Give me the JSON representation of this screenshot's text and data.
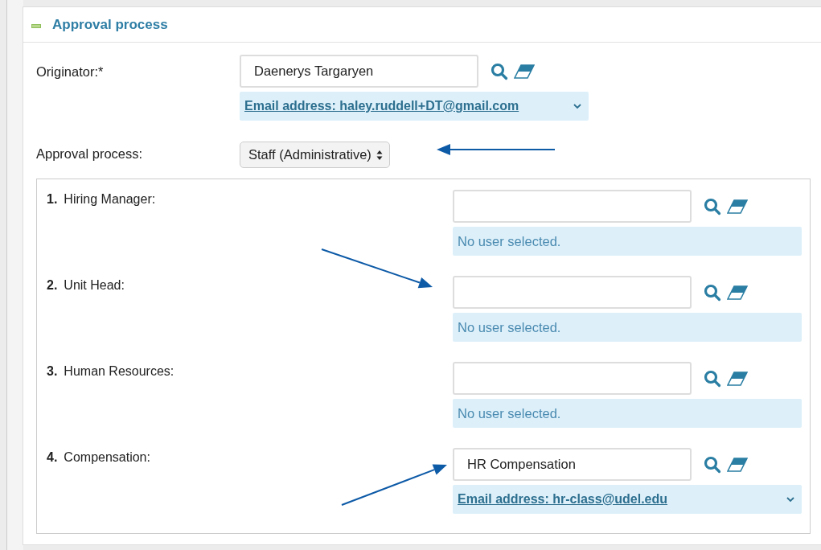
{
  "section": {
    "title": "Approval process",
    "expanded": true
  },
  "originator": {
    "label": "Originator:*",
    "value": "Daenerys Targaryen",
    "info": {
      "kind": "email",
      "text": "Email address: haley.ruddell+DT@gmail.com"
    }
  },
  "approval_process": {
    "label": "Approval process:",
    "value": "Staff (Administrative)"
  },
  "steps": [
    {
      "number": "1.",
      "label": "Hiring Manager:",
      "info": {
        "kind": "empty",
        "text": "No user selected."
      }
    },
    {
      "number": "2.",
      "label": "Unit Head:",
      "info": {
        "kind": "empty",
        "text": "No user selected."
      }
    },
    {
      "number": "3.",
      "label": "Human Resources:",
      "info": {
        "kind": "empty",
        "text": "No user selected."
      }
    },
    {
      "number": "4.",
      "label": "Compensation:",
      "value": "HR Compensation",
      "info": {
        "kind": "email",
        "text": "Email address: hr-class@udel.edu"
      }
    }
  ]
}
